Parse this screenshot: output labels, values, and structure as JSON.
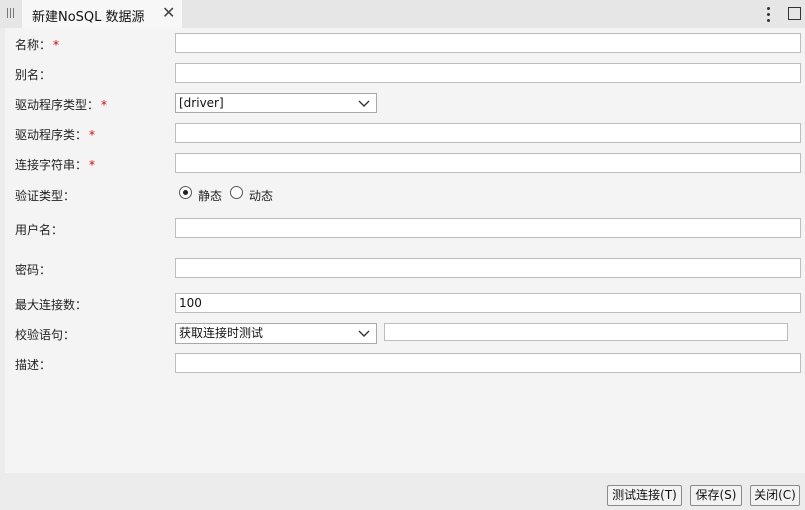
{
  "tab": {
    "title": "新建NoSQL 数据源",
    "close": "✕"
  },
  "form": {
    "name": {
      "label": "名称：",
      "required": "*",
      "value": ""
    },
    "alias": {
      "label": "别名：",
      "value": ""
    },
    "driver_type": {
      "label": "驱动程序类型：",
      "required": "*",
      "value": "[driver]"
    },
    "driver_class": {
      "label": "驱动程序类：",
      "required": "*",
      "value": ""
    },
    "conn_string": {
      "label": "连接字符串：",
      "required": "*",
      "value": ""
    },
    "auth_type": {
      "label": "验证类型：",
      "options": [
        "静态",
        "动态"
      ],
      "selected": "静态"
    },
    "username": {
      "label": "用户名：",
      "value": ""
    },
    "password": {
      "label": "密码：",
      "value": ""
    },
    "max_conn": {
      "label": "最大连接数：",
      "value": "100"
    },
    "validation": {
      "label": "校验语句：",
      "value": "获取连接时测试",
      "extra": ""
    },
    "description": {
      "label": "描述：",
      "value": ""
    }
  },
  "buttons": {
    "test": "测试连接(T)",
    "save": "保存(S)",
    "close": "关闭(C)"
  },
  "icons": {
    "grip": "grip-icon",
    "menu": "more-vertical-icon",
    "maximize": "maximize-icon",
    "chevron": "chevron-down-icon"
  }
}
